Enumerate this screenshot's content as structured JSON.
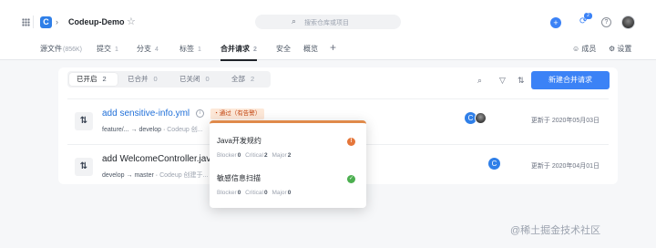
{
  "topbar": {
    "repo_name": "Codeup-Demo",
    "search_placeholder": "搜索仓库或项目",
    "notif_count": "2"
  },
  "tabs": [
    {
      "label": "源文件",
      "count": "(856K)"
    },
    {
      "label": "提交",
      "count": "1"
    },
    {
      "label": "分支",
      "count": "4"
    },
    {
      "label": "标签",
      "count": "1"
    },
    {
      "label": "合并请求",
      "count": "2"
    },
    {
      "label": "安全",
      "count": ""
    },
    {
      "label": "概览",
      "count": ""
    }
  ],
  "tabs_right": {
    "members": "成员",
    "settings": "设置"
  },
  "filters": [
    {
      "label": "已开启",
      "count": "2"
    },
    {
      "label": "已合并",
      "count": "0"
    },
    {
      "label": "已关闭",
      "count": "0"
    },
    {
      "label": "全部",
      "count": "2"
    }
  ],
  "new_mr_label": "新建合并请求",
  "merge_requests": [
    {
      "title": "add sensitive-info.yml",
      "source": "feature/...",
      "arrow": "→",
      "target": "develop",
      "author_note": "Codeup 创...",
      "tag": "通过（有告警）",
      "updated": "更新于 2020年05月03日"
    },
    {
      "title": "add WelcomeController.java",
      "source": "develop",
      "arrow": "→",
      "target": "master",
      "author_note": "Codeup 创建于...",
      "updated": "更新于 2020年04月01日"
    }
  ],
  "popover": {
    "items": [
      {
        "name": "Java开发规约",
        "blocker": "0",
        "critical": "2",
        "major": "2"
      },
      {
        "name": "敏感信息扫描",
        "blocker": "0",
        "critical": "0",
        "major": "0"
      }
    ],
    "labels": {
      "blocker": "Blocker",
      "critical": "Critical",
      "major": "Major"
    }
  },
  "watermark": "@稀土掘金技术社区"
}
